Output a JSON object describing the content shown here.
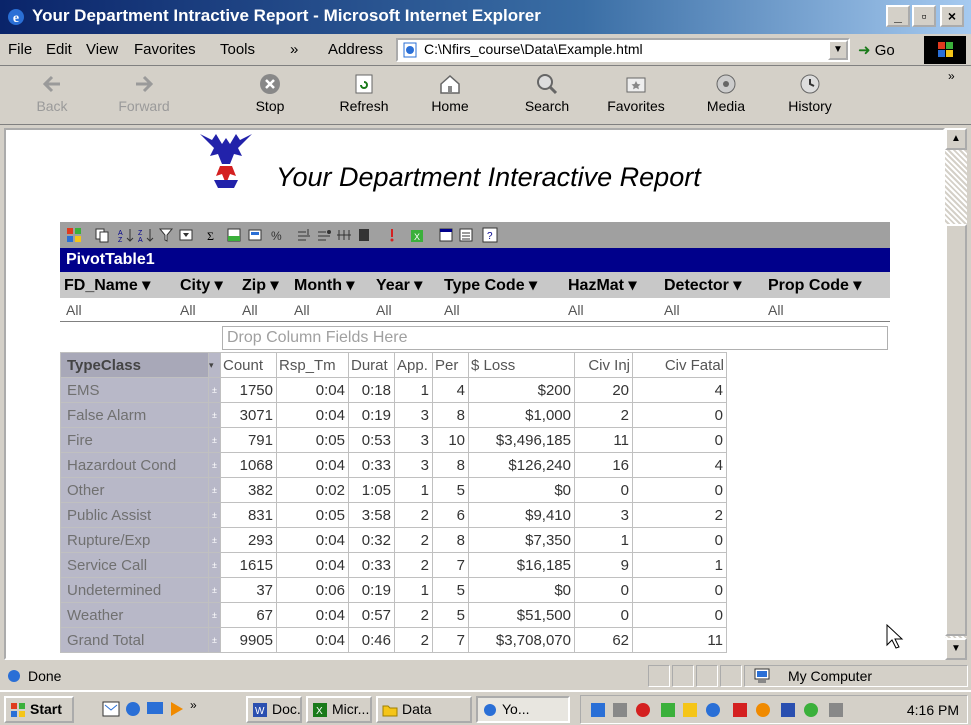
{
  "window": {
    "title": "Your Department Intractive Report - Microsoft Internet Explorer"
  },
  "menu": {
    "items": [
      "File",
      "Edit",
      "View",
      "Favorites",
      "Tools",
      "»"
    ],
    "address_label": "Address",
    "address_value": "C:\\Nfirs_course\\Data\\Example.html",
    "go_label": "Go"
  },
  "toolbar": {
    "buttons": [
      {
        "label": "Back",
        "icon": "back-arrow-icon",
        "enabled": false
      },
      {
        "label": "Forward",
        "icon": "forward-arrow-icon",
        "enabled": false
      },
      {
        "label": "Stop",
        "icon": "stop-icon",
        "enabled": true
      },
      {
        "label": "Refresh",
        "icon": "refresh-icon",
        "enabled": true
      },
      {
        "label": "Home",
        "icon": "home-icon",
        "enabled": true
      },
      {
        "label": "Search",
        "icon": "search-icon",
        "enabled": true
      },
      {
        "label": "Favorites",
        "icon": "favorites-icon",
        "enabled": true
      },
      {
        "label": "Media",
        "icon": "media-icon",
        "enabled": true
      },
      {
        "label": "History",
        "icon": "history-icon",
        "enabled": true
      }
    ],
    "more": "»"
  },
  "page": {
    "title": "Your Department Interactive Report"
  },
  "pivot": {
    "name": "PivotTable1",
    "filters": [
      {
        "field": "FD_Name ▾",
        "value": "All"
      },
      {
        "field": "City ▾",
        "value": "All"
      },
      {
        "field": "Zip ▾",
        "value": "All"
      },
      {
        "field": "Month ▾",
        "value": "All"
      },
      {
        "field": "Year ▾",
        "value": "All"
      },
      {
        "field": "Type Code ▾",
        "value": "All"
      },
      {
        "field": "HazMat ▾",
        "value": "All"
      },
      {
        "field": "Detector ▾",
        "value": "All"
      },
      {
        "field": "Prop Code ▾",
        "value": "All"
      }
    ],
    "drop_zone": "Drop Column Fields Here",
    "row_field": "TypeClass",
    "columns": [
      "Count",
      "Rsp_Tm",
      "Durat",
      "App.",
      "Per",
      "$ Loss",
      "Civ Inj",
      "Civ Fatal"
    ],
    "rows": [
      {
        "label": "EMS",
        "values": [
          "1750",
          "0:04",
          "0:18",
          "1",
          "4",
          "$200",
          "20",
          "4"
        ]
      },
      {
        "label": "False Alarm",
        "values": [
          "3071",
          "0:04",
          "0:19",
          "3",
          "8",
          "$1,000",
          "2",
          "0"
        ]
      },
      {
        "label": "Fire",
        "values": [
          "791",
          "0:05",
          "0:53",
          "3",
          "10",
          "$3,496,185",
          "11",
          "0"
        ]
      },
      {
        "label": "Hazardout Cond",
        "values": [
          "1068",
          "0:04",
          "0:33",
          "3",
          "8",
          "$126,240",
          "16",
          "4"
        ]
      },
      {
        "label": "Other",
        "values": [
          "382",
          "0:02",
          "1:05",
          "1",
          "5",
          "$0",
          "0",
          "0"
        ]
      },
      {
        "label": "Public Assist",
        "values": [
          "831",
          "0:05",
          "3:58",
          "2",
          "6",
          "$9,410",
          "3",
          "2"
        ]
      },
      {
        "label": "Rupture/Exp",
        "values": [
          "293",
          "0:04",
          "0:32",
          "2",
          "8",
          "$7,350",
          "1",
          "0"
        ]
      },
      {
        "label": "Service Call",
        "values": [
          "1615",
          "0:04",
          "0:33",
          "2",
          "7",
          "$16,185",
          "9",
          "1"
        ]
      },
      {
        "label": "Undetermined",
        "values": [
          "37",
          "0:06",
          "0:19",
          "1",
          "5",
          "$0",
          "0",
          "0"
        ]
      },
      {
        "label": "Weather",
        "values": [
          "67",
          "0:04",
          "0:57",
          "2",
          "5",
          "$51,500",
          "0",
          "0"
        ]
      },
      {
        "label": "Grand Total",
        "values": [
          "9905",
          "0:04",
          "0:46",
          "2",
          "7",
          "$3,708,070",
          "62",
          "11"
        ]
      }
    ]
  },
  "status": {
    "text": "Done",
    "zone": "My Computer"
  },
  "taskbar": {
    "start": "Start",
    "tasks": [
      "Doc...",
      "Micr...",
      "Data",
      "Yo..."
    ],
    "clock": "4:16 PM"
  },
  "colors": {
    "titlebar": "#0a246a",
    "pivot_header": "#00008b",
    "row_header": "#b8b8c8",
    "chrome": "#d4d0c8"
  }
}
